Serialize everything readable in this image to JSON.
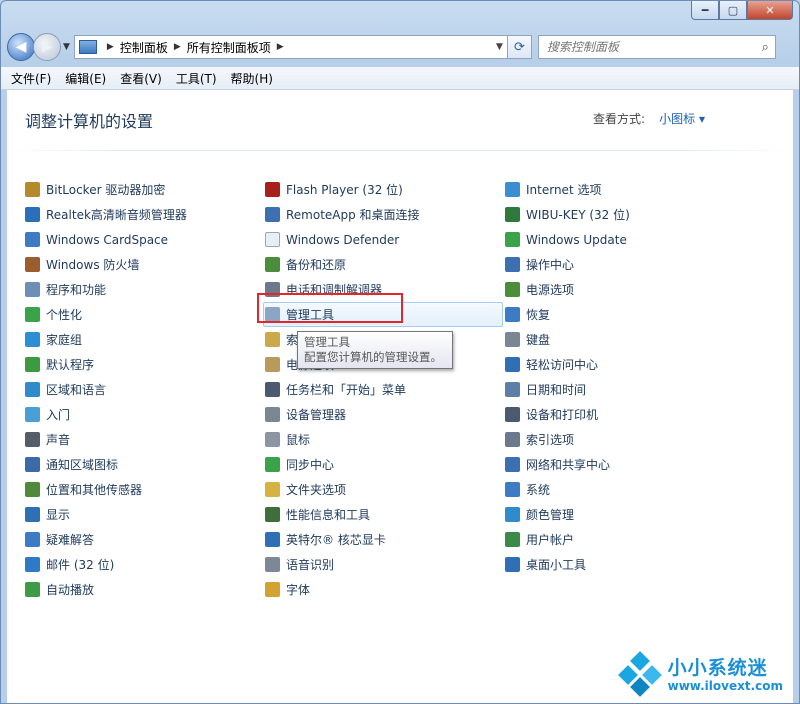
{
  "window": {
    "minimize": "━",
    "maximize": "▢",
    "close": "✕"
  },
  "nav": {
    "breadcrumb": [
      "控制面板",
      "所有控制面板项"
    ],
    "search_placeholder": "搜索控制面板"
  },
  "menu": [
    "文件(F)",
    "编辑(E)",
    "查看(V)",
    "工具(T)",
    "帮助(H)"
  ],
  "header": {
    "title": "调整计算机的设置",
    "view_by_label": "查看方式:",
    "view_by_value": "小图标 ▾"
  },
  "columns": [
    [
      {
        "label": "BitLocker 驱动器加密",
        "icon": "bitlocker-icon",
        "color": "#b58a2a"
      },
      {
        "label": "Realtek高清晰音频管理器",
        "icon": "realtek-audio-icon",
        "color": "#2a6fb8"
      },
      {
        "label": "Windows CardSpace",
        "icon": "cardspace-icon",
        "color": "#3d7cc4"
      },
      {
        "label": "Windows 防火墙",
        "icon": "firewall-icon",
        "color": "#9a5d2e"
      },
      {
        "label": "程序和功能",
        "icon": "programs-icon",
        "color": "#6d8fb5"
      },
      {
        "label": "个性化",
        "icon": "personalize-icon",
        "color": "#3aa34a"
      },
      {
        "label": "家庭组",
        "icon": "homegroup-icon",
        "color": "#2c8fd4"
      },
      {
        "label": "默认程序",
        "icon": "default-programs-icon",
        "color": "#3b9b3e"
      },
      {
        "label": "区域和语言",
        "icon": "region-icon",
        "color": "#2f8bc9"
      },
      {
        "label": "入门",
        "icon": "getting-started-icon",
        "color": "#4a9fd6"
      },
      {
        "label": "声音",
        "icon": "sound-icon",
        "color": "#555d66"
      },
      {
        "label": "通知区域图标",
        "icon": "notification-icon",
        "color": "#3c6aa8"
      },
      {
        "label": "位置和其他传感器",
        "icon": "sensor-icon",
        "color": "#4f8a3a"
      },
      {
        "label": "显示",
        "icon": "display-icon",
        "color": "#2f6fb3"
      },
      {
        "label": "疑难解答",
        "icon": "troubleshoot-icon",
        "color": "#3d7cc4"
      },
      {
        "label": "邮件 (32 位)",
        "icon": "mail-icon",
        "color": "#2e7ac7"
      },
      {
        "label": "自动播放",
        "icon": "autoplay-icon",
        "color": "#3d9b45"
      }
    ],
    [
      {
        "label": "Flash Player (32 位)",
        "icon": "flash-icon",
        "color": "#a8201a"
      },
      {
        "label": "RemoteApp 和桌面连接",
        "icon": "remoteapp-icon",
        "color": "#3d6fb3"
      },
      {
        "label": "Windows Defender",
        "icon": "defender-icon",
        "color": "#e8eef5"
      },
      {
        "label": "备份和还原",
        "icon": "backup-icon",
        "color": "#4a8e3a"
      },
      {
        "label": "电话和调制解调器",
        "icon": "phone-icon",
        "color": "#6a7a8c"
      },
      {
        "label": "管理工具",
        "icon": "admin-tools-icon",
        "color": "#8aa6c4"
      },
      {
        "label": "索引选项",
        "icon": "hidden-item-icon",
        "color": "#c9a94a"
      },
      {
        "label": "电源选项",
        "icon": "hidden-item2-icon",
        "color": "#b89a5a"
      },
      {
        "label": "任务栏和「开始」菜单",
        "icon": "taskbar-icon",
        "color": "#4a5a70"
      },
      {
        "label": "设备管理器",
        "icon": "device-manager-icon",
        "color": "#7a8694"
      },
      {
        "label": "鼠标",
        "icon": "mouse-icon",
        "color": "#8c96a3"
      },
      {
        "label": "同步中心",
        "icon": "sync-icon",
        "color": "#3aa34a"
      },
      {
        "label": "文件夹选项",
        "icon": "folder-options-icon",
        "color": "#d6b341"
      },
      {
        "label": "性能信息和工具",
        "icon": "performance-icon",
        "color": "#3f6e3a"
      },
      {
        "label": "英特尔® 核芯显卡",
        "icon": "intel-graphics-icon",
        "color": "#2f6fb3"
      },
      {
        "label": "语音识别",
        "icon": "speech-icon",
        "color": "#7c8897"
      },
      {
        "label": "字体",
        "icon": "fonts-icon",
        "color": "#d2a330"
      }
    ],
    [
      {
        "label": "Internet 选项",
        "icon": "internet-options-icon",
        "color": "#3b8fd0"
      },
      {
        "label": "WIBU-KEY (32 位)",
        "icon": "wibu-key-icon",
        "color": "#2e7a3a"
      },
      {
        "label": "Windows Update",
        "icon": "windows-update-icon",
        "color": "#3aa34a"
      },
      {
        "label": "操作中心",
        "icon": "action-center-icon",
        "color": "#3d6fb3"
      },
      {
        "label": "电源选项",
        "icon": "power-options-icon",
        "color": "#4a8e3a"
      },
      {
        "label": "恢复",
        "icon": "recovery-icon",
        "color": "#3d7cc4"
      },
      {
        "label": "键盘",
        "icon": "keyboard-icon",
        "color": "#7a8694"
      },
      {
        "label": "轻松访问中心",
        "icon": "ease-of-access-icon",
        "color": "#2f6fb3"
      },
      {
        "label": "日期和时间",
        "icon": "datetime-icon",
        "color": "#5d7fa6"
      },
      {
        "label": "设备和打印机",
        "icon": "devices-printers-icon",
        "color": "#4a5a70"
      },
      {
        "label": "索引选项",
        "icon": "indexing-icon",
        "color": "#6a7a8c"
      },
      {
        "label": "网络和共享中心",
        "icon": "network-icon",
        "color": "#3d6fb3"
      },
      {
        "label": "系统",
        "icon": "system-icon",
        "color": "#3d7cc4"
      },
      {
        "label": "颜色管理",
        "icon": "color-management-icon",
        "color": "#2f8bc9"
      },
      {
        "label": "用户帐户",
        "icon": "user-accounts-icon",
        "color": "#3a8a4a"
      },
      {
        "label": "桌面小工具",
        "icon": "gadgets-icon",
        "color": "#2f6fb3"
      }
    ]
  ],
  "tooltip": {
    "title": "管理工具",
    "desc": "配置您计算机的管理设置。"
  },
  "watermark": {
    "title": "小小系统迷",
    "url": "www.ilovext.com"
  }
}
